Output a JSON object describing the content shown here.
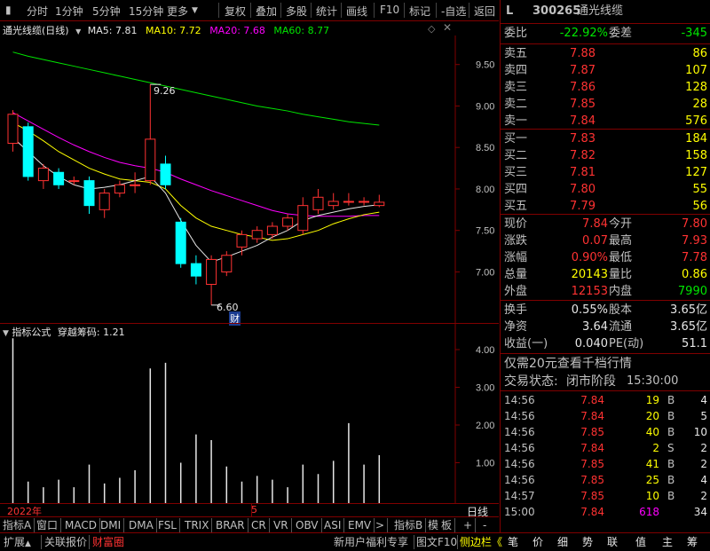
{
  "toolbar": {
    "left": [
      "分时",
      "1分钟",
      "5分钟",
      "15分钟",
      "更多"
    ],
    "right": [
      "复权",
      "叠加",
      "多股",
      "统计",
      "画线",
      "F10",
      "标记",
      "-自选",
      "返回"
    ]
  },
  "chart": {
    "title": "通光线缆(日线)",
    "ma5": "MA5: 7.81",
    "ma10": "MA10: 7.72",
    "ma20": "MA20: 7.68",
    "ma60": "MA60: 8.77",
    "high_label": "9.26",
    "low_label": "6.60",
    "cai_label": "财",
    "y_ticks": [
      "9.50",
      "9.00",
      "8.50",
      "8.00",
      "7.50",
      "7.00"
    ]
  },
  "indicator": {
    "title": "指标公式",
    "name": "穿越筹码: 1.21",
    "y_ticks": [
      "4.00",
      "3.00",
      "2.00",
      "1.00"
    ]
  },
  "xaxis": {
    "year_label": "2022年",
    "month_label": "5",
    "period": "日线"
  },
  "bottom_tabs": [
    "指标A",
    "窗口",
    "MACD",
    "DMI",
    "DMA",
    "FSL",
    "TRIX",
    "BRAR",
    "CR",
    "VR",
    "OBV",
    "ASI",
    "EMV",
    ">",
    "指标B",
    "模",
    "板",
    "+",
    "-"
  ],
  "status_left": [
    "扩展",
    "关联报价",
    "财富圈"
  ],
  "status_mid": [
    "新用户福利专享",
    "图文F10",
    "侧边栏"
  ],
  "status_right": [
    "笔",
    "价",
    "细",
    "势",
    "联",
    "值",
    "主",
    "筹"
  ],
  "stock": {
    "code": "300265",
    "name": "通光线缆",
    "flag": "L"
  },
  "weibi": {
    "label": "委比",
    "value": "-22.92%",
    "diff_label": "委差",
    "diff": "-345"
  },
  "sell": [
    {
      "label": "卖五",
      "price": "7.88",
      "vol": "86"
    },
    {
      "label": "卖四",
      "price": "7.87",
      "vol": "107"
    },
    {
      "label": "卖三",
      "price": "7.86",
      "vol": "128"
    },
    {
      "label": "卖二",
      "price": "7.85",
      "vol": "28"
    },
    {
      "label": "卖一",
      "price": "7.84",
      "vol": "576"
    }
  ],
  "buy": [
    {
      "label": "买一",
      "price": "7.83",
      "vol": "184"
    },
    {
      "label": "买二",
      "price": "7.82",
      "vol": "158"
    },
    {
      "label": "买三",
      "price": "7.81",
      "vol": "127"
    },
    {
      "label": "买四",
      "price": "7.80",
      "vol": "55"
    },
    {
      "label": "买五",
      "price": "7.79",
      "vol": "56"
    }
  ],
  "quote": [
    {
      "l1": "现价",
      "v1": "7.84",
      "c1": "red",
      "l2": "今开",
      "v2": "7.80",
      "c2": "red"
    },
    {
      "l1": "涨跌",
      "v1": "0.07",
      "c1": "red",
      "l2": "最高",
      "v2": "7.93",
      "c2": "red"
    },
    {
      "l1": "涨幅",
      "v1": "0.90%",
      "c1": "red",
      "l2": "最低",
      "v2": "7.78",
      "c2": "red"
    },
    {
      "l1": "总量",
      "v1": "20143",
      "c1": "yellow",
      "l2": "量比",
      "v2": "0.86",
      "c2": "yellow"
    },
    {
      "l1": "外盘",
      "v1": "12153",
      "c1": "red",
      "l2": "内盘",
      "v2": "7990",
      "c2": "green"
    }
  ],
  "fund": [
    {
      "l1": "换手",
      "v1": "0.55%",
      "l2": "股本",
      "v2": "3.65亿"
    },
    {
      "l1": "净资",
      "v1": "3.64",
      "l2": "流通",
      "v2": "3.65亿"
    },
    {
      "l1": "收益(一)",
      "v1": "0.040",
      "l2": "PE(动)",
      "v2": "51.1"
    }
  ],
  "promo": "仅需20元查看千档行情",
  "trade_status": {
    "label": "交易状态:",
    "value": "闭市阶段",
    "time": "15:30:00"
  },
  "ticks": [
    {
      "time": "14:56",
      "price": "7.84",
      "vol": "19",
      "side": "B",
      "cnt": "4"
    },
    {
      "time": "14:56",
      "price": "7.84",
      "vol": "20",
      "side": "B",
      "cnt": "5"
    },
    {
      "time": "14:56",
      "price": "7.85",
      "vol": "40",
      "side": "B",
      "cnt": "10"
    },
    {
      "time": "14:56",
      "price": "7.84",
      "vol": "2",
      "side": "S",
      "cnt": "2"
    },
    {
      "time": "14:56",
      "price": "7.85",
      "vol": "41",
      "side": "B",
      "cnt": "2"
    },
    {
      "time": "14:56",
      "price": "7.85",
      "vol": "25",
      "side": "B",
      "cnt": "4"
    },
    {
      "time": "14:57",
      "price": "7.85",
      "vol": "10",
      "side": "B",
      "cnt": "2"
    },
    {
      "time": "15:00",
      "price": "7.84",
      "vol": "618",
      "side": "",
      "cnt": "34"
    }
  ],
  "chart_data": {
    "type": "candlestick",
    "ylim": [
      6.5,
      9.7
    ],
    "candles": [
      {
        "o": 8.55,
        "c": 8.9,
        "h": 8.95,
        "l": 8.45
      },
      {
        "o": 8.75,
        "c": 8.15,
        "h": 8.8,
        "l": 8.1
      },
      {
        "o": 8.1,
        "c": 8.25,
        "h": 8.3,
        "l": 8.0
      },
      {
        "o": 8.2,
        "c": 8.05,
        "h": 8.25,
        "l": 8.0
      },
      {
        "o": 8.1,
        "c": 8.1,
        "h": 8.15,
        "l": 8.05
      },
      {
        "o": 8.1,
        "c": 7.8,
        "h": 8.15,
        "l": 7.7
      },
      {
        "o": 7.75,
        "c": 7.95,
        "h": 8.0,
        "l": 7.65
      },
      {
        "o": 7.95,
        "c": 8.05,
        "h": 8.1,
        "l": 7.9
      },
      {
        "o": 8.05,
        "c": 8.05,
        "h": 8.2,
        "l": 7.95
      },
      {
        "o": 8.1,
        "c": 8.6,
        "h": 9.26,
        "l": 8.05
      },
      {
        "o": 8.3,
        "c": 8.05,
        "h": 8.4,
        "l": 8.0
      },
      {
        "o": 7.6,
        "c": 7.1,
        "h": 7.65,
        "l": 7.05
      },
      {
        "o": 7.1,
        "c": 6.95,
        "h": 7.2,
        "l": 6.85
      },
      {
        "o": 6.85,
        "c": 7.15,
        "h": 7.2,
        "l": 6.6
      },
      {
        "o": 7.0,
        "c": 7.2,
        "h": 7.25,
        "l": 6.95
      },
      {
        "o": 7.3,
        "c": 7.45,
        "h": 7.5,
        "l": 7.2
      },
      {
        "o": 7.4,
        "c": 7.5,
        "h": 7.55,
        "l": 7.35
      },
      {
        "o": 7.45,
        "c": 7.55,
        "h": 7.6,
        "l": 7.4
      },
      {
        "o": 7.55,
        "c": 7.65,
        "h": 7.7,
        "l": 7.5
      },
      {
        "o": 7.5,
        "c": 7.8,
        "h": 7.9,
        "l": 7.45
      },
      {
        "o": 7.75,
        "c": 7.9,
        "h": 8.0,
        "l": 7.7
      },
      {
        "o": 7.8,
        "c": 7.85,
        "h": 7.95,
        "l": 7.75
      },
      {
        "o": 7.85,
        "c": 7.85,
        "h": 7.95,
        "l": 7.8
      },
      {
        "o": 7.85,
        "c": 7.85,
        "h": 7.9,
        "l": 7.8
      },
      {
        "o": 7.8,
        "c": 7.84,
        "h": 7.93,
        "l": 7.78
      }
    ],
    "ma5": [
      8.62,
      8.45,
      8.28,
      8.15,
      8.05,
      8.0,
      8.02,
      8.05,
      8.1,
      8.15,
      7.95,
      7.62,
      7.32,
      7.12,
      7.18,
      7.25,
      7.32,
      7.42,
      7.5,
      7.62,
      7.68,
      7.72,
      7.76,
      7.79,
      7.81
    ],
    "ma10": [
      8.8,
      8.7,
      8.58,
      8.45,
      8.35,
      8.25,
      8.18,
      8.12,
      8.1,
      8.08,
      8.0,
      7.8,
      7.65,
      7.55,
      7.5,
      7.45,
      7.42,
      7.38,
      7.4,
      7.45,
      7.5,
      7.58,
      7.64,
      7.69,
      7.72
    ],
    "ma20": [
      8.92,
      8.82,
      8.72,
      8.62,
      8.53,
      8.45,
      8.38,
      8.32,
      8.28,
      8.25,
      8.2,
      8.12,
      8.05,
      7.98,
      7.92,
      7.86,
      7.8,
      7.74,
      7.7,
      7.68,
      7.67,
      7.67,
      7.67,
      7.68,
      7.68
    ],
    "ma60": [
      9.65,
      9.6,
      9.56,
      9.52,
      9.48,
      9.44,
      9.4,
      9.36,
      9.32,
      9.28,
      9.24,
      9.2,
      9.16,
      9.12,
      9.08,
      9.04,
      9.0,
      8.97,
      8.94,
      8.9,
      8.87,
      8.84,
      8.81,
      8.79,
      8.77
    ],
    "volume_ylim": [
      0,
      4.7
    ],
    "volume": [
      4.3,
      0.5,
      0.35,
      0.55,
      0.35,
      0.95,
      0.45,
      0.6,
      0.8,
      3.5,
      3.65,
      1.0,
      1.75,
      1.6,
      0.9,
      0.5,
      0.65,
      0.55,
      0.35,
      0.95,
      0.7,
      1.05,
      2.05,
      0.95,
      1.2
    ]
  }
}
